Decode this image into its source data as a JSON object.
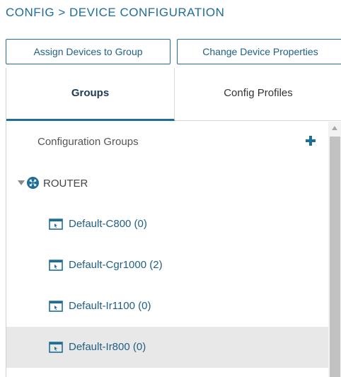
{
  "breadcrumb": "CONFIG > DEVICE CONFIGURATION",
  "toolbar": {
    "assign_label": "Assign Devices to Group",
    "change_label": "Change Device Properties"
  },
  "tabs": [
    {
      "label": "Groups",
      "active": true
    },
    {
      "label": "Config Profiles",
      "active": false
    }
  ],
  "tree": {
    "header_label": "Configuration Groups",
    "add_icon": "plus-icon",
    "root": {
      "label": "ROUTER",
      "expanded": true,
      "icon": "router-icon",
      "children": [
        {
          "label": "Default-C800 (0)",
          "icon": "config-group-icon",
          "selected": false
        },
        {
          "label": "Default-Cgr1000 (2)",
          "icon": "config-group-icon",
          "selected": false
        },
        {
          "label": "Default-Ir1100 (0)",
          "icon": "config-group-icon",
          "selected": false
        },
        {
          "label": "Default-Ir800 (0)",
          "icon": "config-group-icon",
          "selected": true
        }
      ]
    }
  },
  "colors": {
    "accent": "#1f6d99",
    "link_text": "#1f5f86",
    "selected_row": "#e8e8e8"
  }
}
